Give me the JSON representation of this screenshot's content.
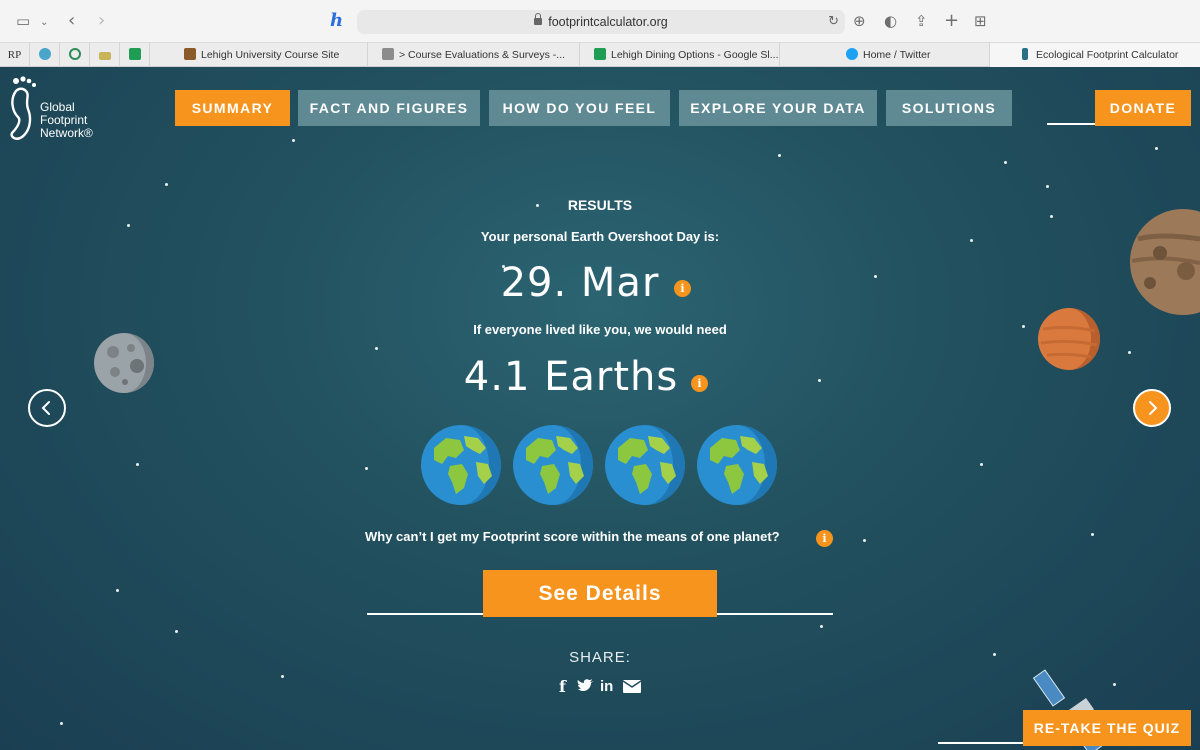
{
  "browser": {
    "url": "footprintcalculator.org",
    "bookmarks": [
      {
        "label": "RP"
      },
      {
        "label": ""
      },
      {
        "label": ""
      },
      {
        "label": ""
      },
      {
        "label": ""
      },
      {
        "label": "Lehigh University Course Site"
      },
      {
        "label": "> Course Evaluations & Surveys -..."
      },
      {
        "label": "Lehigh Dining Options - Google Sl..."
      },
      {
        "label": "Home / Twitter"
      },
      {
        "label": "Ecological Footprint Calculator"
      }
    ]
  },
  "header": {
    "logo_lines": [
      "Global",
      "Footprint",
      "Network®"
    ],
    "nav": [
      {
        "label": "SUMMARY",
        "active": true
      },
      {
        "label": "FACT AND FIGURES",
        "active": false
      },
      {
        "label": "HOW DO YOU FEEL",
        "active": false
      },
      {
        "label": "EXPLORE YOUR DATA",
        "active": false
      },
      {
        "label": "SOLUTIONS",
        "active": false
      }
    ],
    "donate_label": "DONATE"
  },
  "results": {
    "heading": "RESULTS",
    "overshoot_label": "Your personal Earth Overshoot Day is:",
    "overshoot_day": "29. Mar",
    "need_label": "If everyone lived like you, we would need",
    "earths_value": "4.1 Earths",
    "earths_count": 4.1,
    "why_label": "Why can’t I get my Footprint score within the means of one planet?",
    "details_button": "See Details",
    "share_label": "SHARE:",
    "share_icons": [
      "facebook-icon",
      "twitter-icon",
      "linkedin-icon",
      "email-icon"
    ],
    "retake_button": "RE-TAKE THE QUIZ"
  },
  "colors": {
    "accent": "#f7941e",
    "nav_inactive": "#5f8a94",
    "background": "#1d4a5c"
  }
}
